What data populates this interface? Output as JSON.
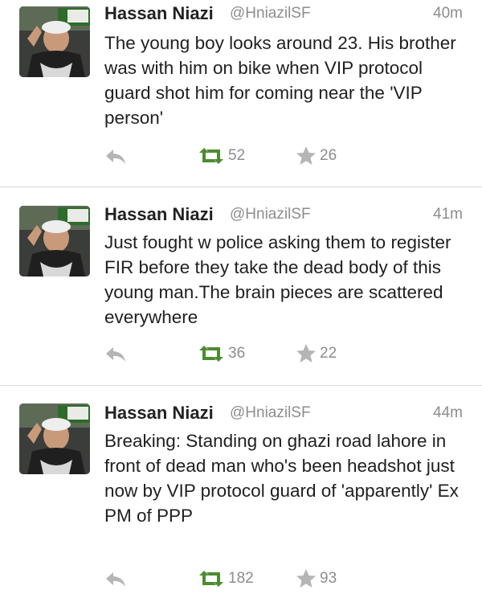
{
  "tweets": [
    {
      "display_name": "Hassan Niazi",
      "handle": "@HniazilSF",
      "time": "40m",
      "text": "The young boy looks around 23. His brother was with him on bike when VIP protocol guard shot him for coming near the 'VIP person'",
      "retweets": "52",
      "favorites": "26"
    },
    {
      "display_name": "Hassan Niazi",
      "handle": "@HniazilSF",
      "time": "41m",
      "text": "Just fought w police asking them to register FIR before they take the dead body of this young man.The brain pieces are scattered everywhere",
      "retweets": "36",
      "favorites": "22"
    },
    {
      "display_name": "Hassan Niazi",
      "handle": "@HniazilSF",
      "time": "44m",
      "text": "Breaking: Standing on ghazi road lahore in front of dead man who's been headshot just now by VIP protocol guard of 'apparently' Ex PM of PPP",
      "retweets": "182",
      "favorites": "93"
    }
  ],
  "colors": {
    "retweet_green": "#4d8b2f",
    "icon_gray": "#b5b5b5",
    "meta_gray": "#8d8d8d",
    "divider": "#d9d9d9"
  },
  "icons": {
    "reply": "reply-icon",
    "retweet": "retweet-icon",
    "favorite": "star-icon"
  }
}
